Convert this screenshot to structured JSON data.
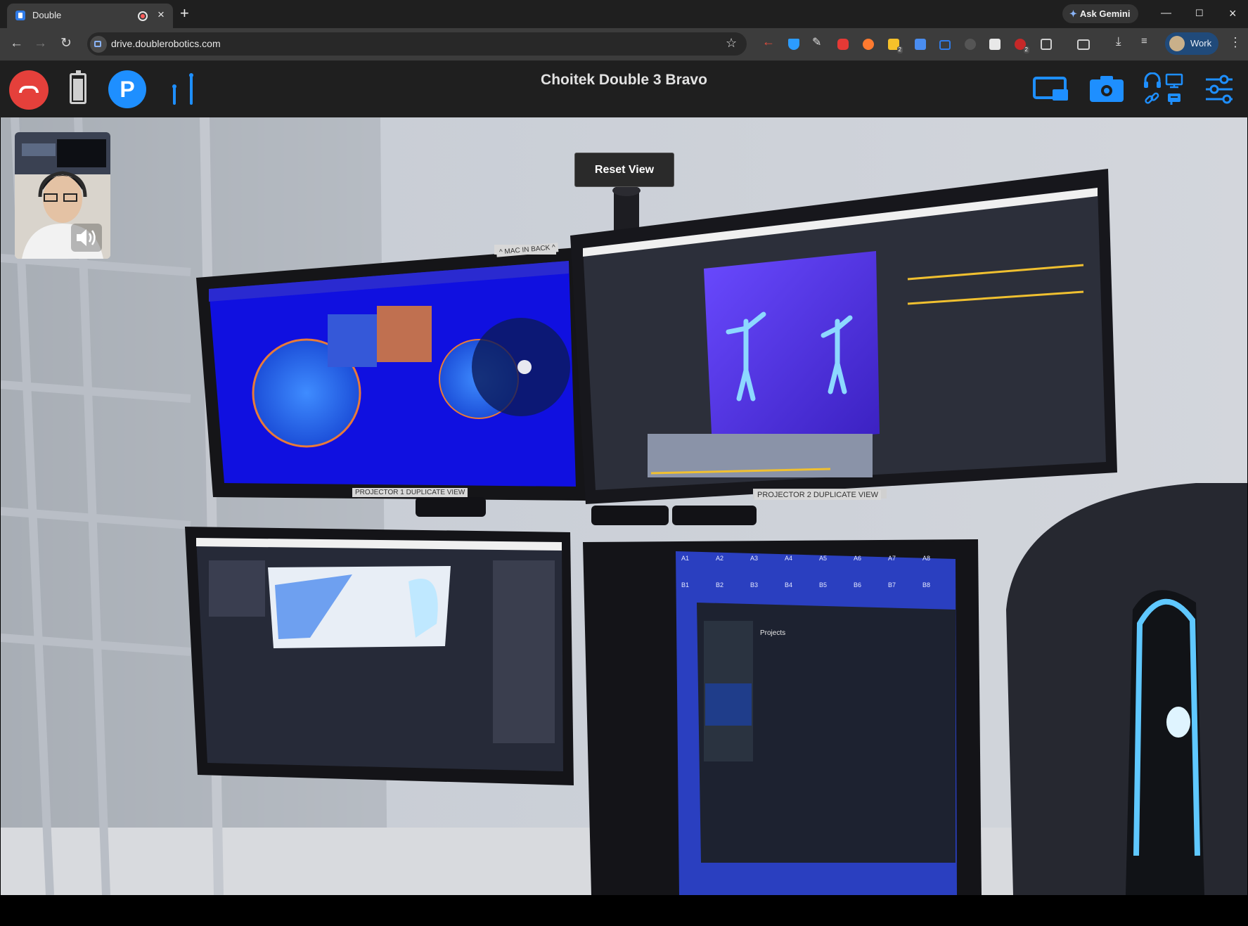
{
  "browser": {
    "tab_title": "Double",
    "url": "drive.doublerobotics.com",
    "gemini_label": "Ask Gemini",
    "profile_label": "Work",
    "ext_badges": [
      "2",
      "2"
    ]
  },
  "app": {
    "title": "Choitek Double 3 Bravo",
    "reset_view_label": "Reset View",
    "parking_letter": "P",
    "colors": {
      "accent": "#1e8fff",
      "hangup": "#e5403b",
      "header_bg": "#1f1f1f"
    }
  },
  "scene": {
    "label_mac_in_back": "^ MAC IN BACK ^",
    "label_projector1": "PROJECTOR 1 DUPLICATE VIEW",
    "label_projector2": "PROJECTOR 2 DUPLICATE VIEW",
    "unity_projects_title": "Projects",
    "grid_labels": [
      "A1",
      "A2",
      "A3",
      "A4",
      "A5",
      "A6",
      "A7",
      "A8",
      "B1",
      "B2",
      "B3",
      "B4",
      "B5",
      "B6",
      "B7",
      "B8"
    ]
  },
  "icons": {
    "hangup": "phone-hangup-icon",
    "battery": "battery-icon",
    "pole": "pole-height-icon",
    "screen_share": "screen-share-icon",
    "camera": "camera-icon",
    "settings": "sliders-icon"
  }
}
